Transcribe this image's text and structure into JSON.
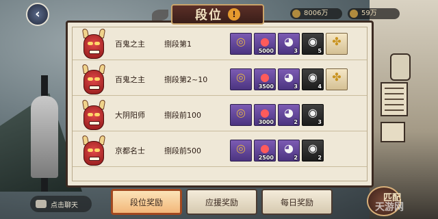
{
  "header": {
    "title": "段位",
    "info_mark": "!",
    "resource_1": "8006万",
    "resource_2": "59万"
  },
  "rows": [
    {
      "name": "百鬼之主",
      "rank": "捌段第1",
      "rewards": [
        {
          "icon": "ring-relic-icon",
          "style": "purple",
          "count": ""
        },
        {
          "icon": "red-orb-icon",
          "style": "purple",
          "count": "5000"
        },
        {
          "icon": "daruma-icon",
          "style": "purple",
          "count": "3"
        },
        {
          "icon": "black-daruma-mask-icon",
          "style": "dark",
          "count": "5"
        },
        {
          "icon": "gold-gem-icon",
          "style": "gold",
          "count": ""
        }
      ]
    },
    {
      "name": "百鬼之主",
      "rank": "捌段第2~10",
      "rewards": [
        {
          "icon": "ring-relic-icon",
          "style": "purple",
          "count": ""
        },
        {
          "icon": "red-orb-icon",
          "style": "purple",
          "count": "3500"
        },
        {
          "icon": "daruma-icon",
          "style": "purple",
          "count": "3"
        },
        {
          "icon": "black-daruma-mask-icon",
          "style": "dark",
          "count": "4"
        },
        {
          "icon": "gold-gem-icon",
          "style": "gold",
          "count": ""
        }
      ]
    },
    {
      "name": "大阴阳师",
      "rank": "捌段前100",
      "rewards": [
        {
          "icon": "ring-relic-icon",
          "style": "purple",
          "count": ""
        },
        {
          "icon": "red-orb-icon",
          "style": "purple",
          "count": "3000"
        },
        {
          "icon": "daruma-icon",
          "style": "purple",
          "count": "2"
        },
        {
          "icon": "black-daruma-mask-icon",
          "style": "dark",
          "count": "3"
        }
      ]
    },
    {
      "name": "京都名士",
      "rank": "捌段前500",
      "rewards": [
        {
          "icon": "ring-relic-icon",
          "style": "purple",
          "count": ""
        },
        {
          "icon": "red-orb-icon",
          "style": "purple",
          "count": "2500"
        },
        {
          "icon": "daruma-icon",
          "style": "purple",
          "count": "2"
        },
        {
          "icon": "black-daruma-mask-icon",
          "style": "dark",
          "count": "2"
        }
      ]
    }
  ],
  "tabs": [
    {
      "label": "段位奖励",
      "active": true
    },
    {
      "label": "应援奖励",
      "active": false
    },
    {
      "label": "每日奖励",
      "active": false
    }
  ],
  "chat": {
    "label": "点击聊天"
  },
  "match": {
    "label": "匹配"
  },
  "watermark": "天游网"
}
